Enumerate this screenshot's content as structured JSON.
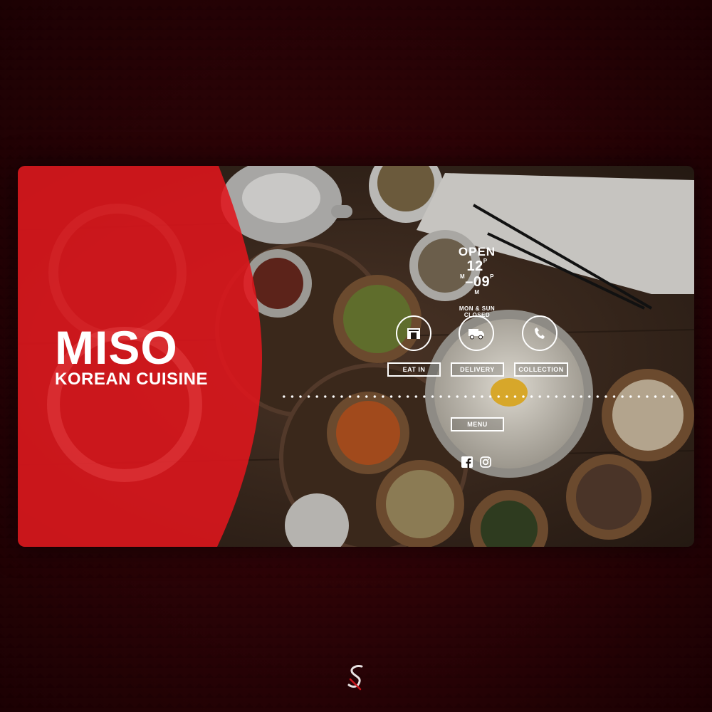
{
  "brand": {
    "name": "MISO",
    "subtitle": "KOREAN CUISINE"
  },
  "hours": {
    "status": "OPEN",
    "open_hour": "12",
    "close_hour": "09",
    "open_suffix_top": "P",
    "open_suffix_bottom": "M",
    "close_suffix_top": "P",
    "close_suffix_bottom": "M",
    "separator": "–",
    "closed_days": "MON & SUN",
    "closed_label": "CLOSED"
  },
  "services": [
    {
      "label": "EAT IN",
      "icon": "store-icon"
    },
    {
      "label": "DELIVERY",
      "icon": "truck-icon"
    },
    {
      "label": "COLLECTION",
      "icon": "phone-icon"
    }
  ],
  "menu": {
    "label": "MENU"
  },
  "social": [
    {
      "icon": "facebook-icon"
    },
    {
      "icon": "instagram-icon"
    }
  ],
  "colors": {
    "accent_red": "#e0161c",
    "background": "#2a0306",
    "text": "#ffffff"
  }
}
